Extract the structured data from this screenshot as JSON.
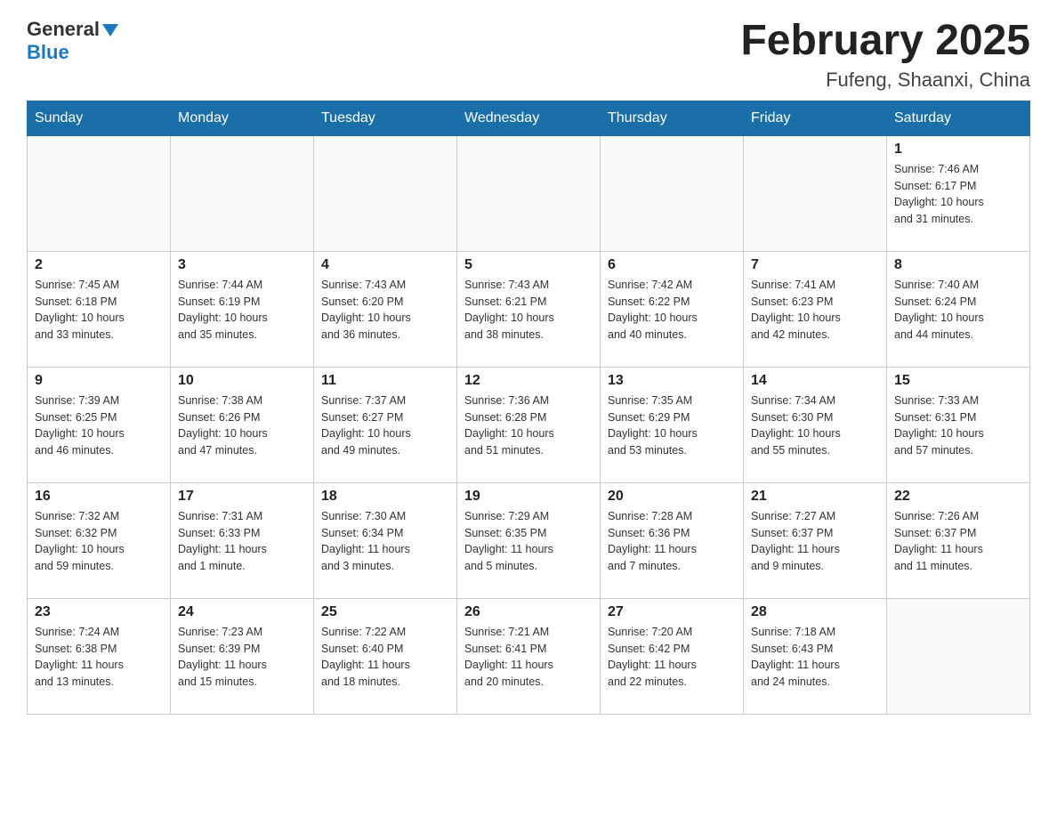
{
  "header": {
    "logo_general": "General",
    "logo_blue": "Blue",
    "month_title": "February 2025",
    "location": "Fufeng, Shaanxi, China"
  },
  "weekdays": [
    "Sunday",
    "Monday",
    "Tuesday",
    "Wednesday",
    "Thursday",
    "Friday",
    "Saturday"
  ],
  "weeks": [
    [
      {
        "day": "",
        "info": ""
      },
      {
        "day": "",
        "info": ""
      },
      {
        "day": "",
        "info": ""
      },
      {
        "day": "",
        "info": ""
      },
      {
        "day": "",
        "info": ""
      },
      {
        "day": "",
        "info": ""
      },
      {
        "day": "1",
        "info": "Sunrise: 7:46 AM\nSunset: 6:17 PM\nDaylight: 10 hours\nand 31 minutes."
      }
    ],
    [
      {
        "day": "2",
        "info": "Sunrise: 7:45 AM\nSunset: 6:18 PM\nDaylight: 10 hours\nand 33 minutes."
      },
      {
        "day": "3",
        "info": "Sunrise: 7:44 AM\nSunset: 6:19 PM\nDaylight: 10 hours\nand 35 minutes."
      },
      {
        "day": "4",
        "info": "Sunrise: 7:43 AM\nSunset: 6:20 PM\nDaylight: 10 hours\nand 36 minutes."
      },
      {
        "day": "5",
        "info": "Sunrise: 7:43 AM\nSunset: 6:21 PM\nDaylight: 10 hours\nand 38 minutes."
      },
      {
        "day": "6",
        "info": "Sunrise: 7:42 AM\nSunset: 6:22 PM\nDaylight: 10 hours\nand 40 minutes."
      },
      {
        "day": "7",
        "info": "Sunrise: 7:41 AM\nSunset: 6:23 PM\nDaylight: 10 hours\nand 42 minutes."
      },
      {
        "day": "8",
        "info": "Sunrise: 7:40 AM\nSunset: 6:24 PM\nDaylight: 10 hours\nand 44 minutes."
      }
    ],
    [
      {
        "day": "9",
        "info": "Sunrise: 7:39 AM\nSunset: 6:25 PM\nDaylight: 10 hours\nand 46 minutes."
      },
      {
        "day": "10",
        "info": "Sunrise: 7:38 AM\nSunset: 6:26 PM\nDaylight: 10 hours\nand 47 minutes."
      },
      {
        "day": "11",
        "info": "Sunrise: 7:37 AM\nSunset: 6:27 PM\nDaylight: 10 hours\nand 49 minutes."
      },
      {
        "day": "12",
        "info": "Sunrise: 7:36 AM\nSunset: 6:28 PM\nDaylight: 10 hours\nand 51 minutes."
      },
      {
        "day": "13",
        "info": "Sunrise: 7:35 AM\nSunset: 6:29 PM\nDaylight: 10 hours\nand 53 minutes."
      },
      {
        "day": "14",
        "info": "Sunrise: 7:34 AM\nSunset: 6:30 PM\nDaylight: 10 hours\nand 55 minutes."
      },
      {
        "day": "15",
        "info": "Sunrise: 7:33 AM\nSunset: 6:31 PM\nDaylight: 10 hours\nand 57 minutes."
      }
    ],
    [
      {
        "day": "16",
        "info": "Sunrise: 7:32 AM\nSunset: 6:32 PM\nDaylight: 10 hours\nand 59 minutes."
      },
      {
        "day": "17",
        "info": "Sunrise: 7:31 AM\nSunset: 6:33 PM\nDaylight: 11 hours\nand 1 minute."
      },
      {
        "day": "18",
        "info": "Sunrise: 7:30 AM\nSunset: 6:34 PM\nDaylight: 11 hours\nand 3 minutes."
      },
      {
        "day": "19",
        "info": "Sunrise: 7:29 AM\nSunset: 6:35 PM\nDaylight: 11 hours\nand 5 minutes."
      },
      {
        "day": "20",
        "info": "Sunrise: 7:28 AM\nSunset: 6:36 PM\nDaylight: 11 hours\nand 7 minutes."
      },
      {
        "day": "21",
        "info": "Sunrise: 7:27 AM\nSunset: 6:37 PM\nDaylight: 11 hours\nand 9 minutes."
      },
      {
        "day": "22",
        "info": "Sunrise: 7:26 AM\nSunset: 6:37 PM\nDaylight: 11 hours\nand 11 minutes."
      }
    ],
    [
      {
        "day": "23",
        "info": "Sunrise: 7:24 AM\nSunset: 6:38 PM\nDaylight: 11 hours\nand 13 minutes."
      },
      {
        "day": "24",
        "info": "Sunrise: 7:23 AM\nSunset: 6:39 PM\nDaylight: 11 hours\nand 15 minutes."
      },
      {
        "day": "25",
        "info": "Sunrise: 7:22 AM\nSunset: 6:40 PM\nDaylight: 11 hours\nand 18 minutes."
      },
      {
        "day": "26",
        "info": "Sunrise: 7:21 AM\nSunset: 6:41 PM\nDaylight: 11 hours\nand 20 minutes."
      },
      {
        "day": "27",
        "info": "Sunrise: 7:20 AM\nSunset: 6:42 PM\nDaylight: 11 hours\nand 22 minutes."
      },
      {
        "day": "28",
        "info": "Sunrise: 7:18 AM\nSunset: 6:43 PM\nDaylight: 11 hours\nand 24 minutes."
      },
      {
        "day": "",
        "info": ""
      }
    ]
  ]
}
